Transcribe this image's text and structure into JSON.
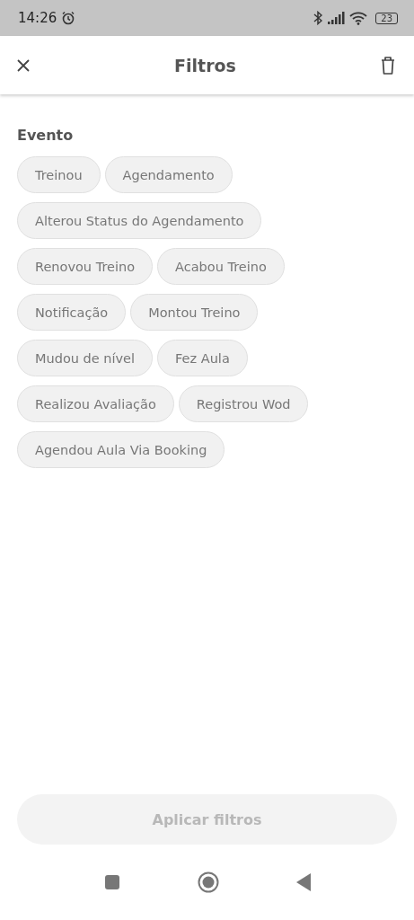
{
  "status_bar": {
    "time": "14:26",
    "battery": "23"
  },
  "header": {
    "title": "Filtros"
  },
  "section": {
    "title": "Evento"
  },
  "chips": [
    {
      "label": "Treinou",
      "selected": false
    },
    {
      "label": "Agendamento",
      "selected": false
    },
    {
      "label": "Alterou Status do Agendamento",
      "selected": false
    },
    {
      "label": "Renovou Treino",
      "selected": false
    },
    {
      "label": "Acabou Treino",
      "selected": false
    },
    {
      "label": "Notificação",
      "selected": false
    },
    {
      "label": "Montou Treino",
      "selected": false
    },
    {
      "label": "Mudou de nível",
      "selected": false
    },
    {
      "label": "Fez Aula",
      "selected": false
    },
    {
      "label": "Realizou Avaliação",
      "selected": false
    },
    {
      "label": "Registrou Wod",
      "selected": false
    },
    {
      "label": "Agendou Aula Via Booking",
      "selected": false
    }
  ],
  "apply_button": {
    "label": "Aplicar filtros",
    "disabled": true
  }
}
